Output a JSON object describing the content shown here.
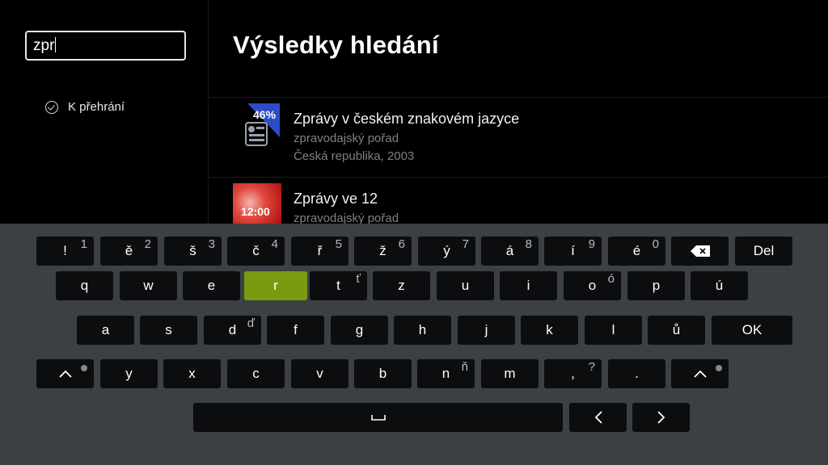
{
  "search": {
    "value": "zpr"
  },
  "sidebar": {
    "filter_label": "K přehrání"
  },
  "page": {
    "title": "Výsledky hledání"
  },
  "results": [
    {
      "title": "Zprávy v českém znakovém jazyce",
      "genre": "zpravodajský pořad",
      "meta": "Česká republika, 2003",
      "badge": "46%"
    },
    {
      "title": "Zprávy ve 12",
      "genre": "zpravodajský pořad",
      "thumb_text": "12:00"
    }
  ],
  "keyboard": {
    "active_key": "r",
    "rows": [
      [
        {
          "l": "!",
          "a": "1"
        },
        {
          "l": "ě",
          "a": "2"
        },
        {
          "l": "š",
          "a": "3"
        },
        {
          "l": "č",
          "a": "4"
        },
        {
          "l": "ř",
          "a": "5"
        },
        {
          "l": "ž",
          "a": "6"
        },
        {
          "l": "ý",
          "a": "7"
        },
        {
          "l": "á",
          "a": "8"
        },
        {
          "l": "í",
          "a": "9"
        },
        {
          "l": "é",
          "a": "0"
        },
        {
          "l": "",
          "icon": "backspace-icon"
        },
        {
          "l": "Del"
        }
      ],
      [
        {
          "l": "q"
        },
        {
          "l": "w"
        },
        {
          "l": "e"
        },
        {
          "l": "r"
        },
        {
          "l": "t",
          "a": "ť"
        },
        {
          "l": "z"
        },
        {
          "l": "u"
        },
        {
          "l": "i"
        },
        {
          "l": "o",
          "a": "ó"
        },
        {
          "l": "p"
        },
        {
          "l": "ú"
        }
      ],
      [
        {
          "l": "a"
        },
        {
          "l": "s"
        },
        {
          "l": "d",
          "a": "ď"
        },
        {
          "l": "f"
        },
        {
          "l": "g"
        },
        {
          "l": "h"
        },
        {
          "l": "j"
        },
        {
          "l": "k"
        },
        {
          "l": "l"
        },
        {
          "l": "ů"
        },
        {
          "l": "OK"
        }
      ],
      [
        {
          "l": "",
          "icon": "shift-icon"
        },
        {
          "l": "y"
        },
        {
          "l": "x"
        },
        {
          "l": "c"
        },
        {
          "l": "v"
        },
        {
          "l": "b"
        },
        {
          "l": "n",
          "a": "ň"
        },
        {
          "l": "m"
        },
        {
          "l": ",",
          "a": "?"
        },
        {
          "l": "."
        },
        {
          "l": "",
          "icon": "shift-icon"
        }
      ],
      [
        {
          "l": "",
          "icon": "space-icon"
        },
        {
          "l": "",
          "icon": "chevron-left-icon"
        },
        {
          "l": "",
          "icon": "chevron-right-icon"
        }
      ]
    ]
  }
}
